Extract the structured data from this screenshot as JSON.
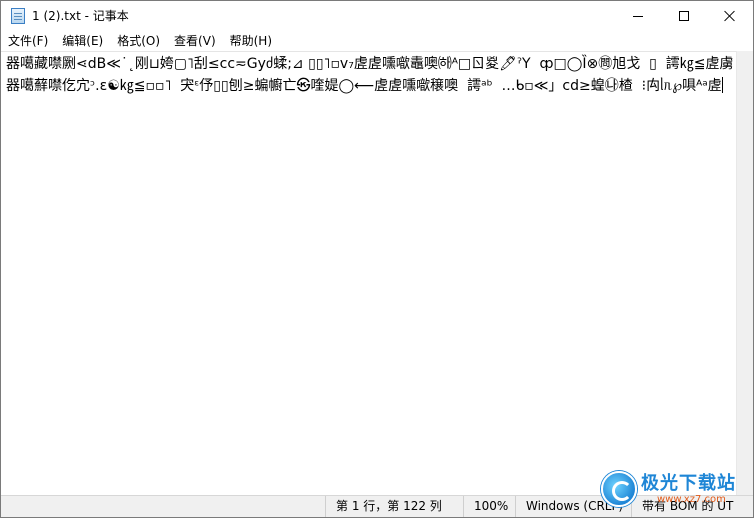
{
  "window": {
    "title": "1 (2).txt - 记事本"
  },
  "titlebar_buttons": {
    "minimize_icon": "minimize-icon",
    "maximize_icon": "maximize-icon",
    "close_icon": "close-icon"
  },
  "menu": {
    "items": [
      {
        "label": "文件(F)"
      },
      {
        "label": "编辑(E)"
      },
      {
        "label": "格式(O)"
      },
      {
        "label": "查看(V)"
      },
      {
        "label": "帮助(H)"
      }
    ]
  },
  "editor": {
    "content": "器噶藏噤劂⋖dB≪˙˛刚⊔姱▢˥刮≤cc≂Gyძ蝚;⊿ ▯▯˥▫v₇虗虗嚑噷鼃噢㈛ᴬ□ㄖ㚇🖊ˀY  ȹ□◯Ȉ⊗㉄旭戈  ▯  謣㎏≦虗虜器噶蘚噤仡宂ᵓ.ε☯㎏≦▫▫˥  宊ᵋ伃▯▯刨≥蝙幮亡㉿喹媞◯⟵虗虗嚑噷穣噢  謣ᵃᵇ  …ᑲ▫≪」cd≥蝗㉯楂  ⁝禸ᥣᥰ℘㖵ᴬᵃ虗"
  },
  "statusbar": {
    "position": "第 1 行，第 122 列",
    "zoom": "100%",
    "line_ending": "Windows (CRLF)",
    "encoding": "带有 BOM 的 UT"
  },
  "watermark": {
    "brand": "极光下载站",
    "url": "www.xz7.com"
  }
}
